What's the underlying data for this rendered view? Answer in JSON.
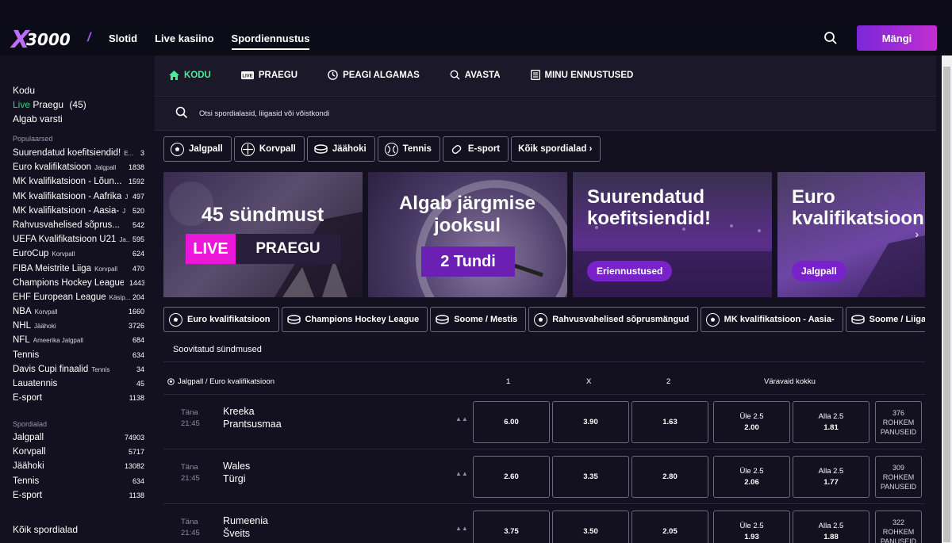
{
  "header": {
    "logo_text": "3000",
    "logo_mark": "X",
    "nav": [
      "Slotid",
      "Live kasiino",
      "Spordiennustus"
    ],
    "play_button": "Mängi"
  },
  "sidebar": {
    "main_items": [
      {
        "label": "Kodu"
      },
      {
        "label_live": "Live",
        "label": "Praegu",
        "count": "(45)"
      },
      {
        "label": "Algab varsti"
      }
    ],
    "popular_heading": "Populaarsed",
    "popular": [
      {
        "name": "Suurendatud koefitsiendid!",
        "sub": "E...",
        "count": "3"
      },
      {
        "name": "Euro kvalifikatsioon",
        "sub": "Jalgpall",
        "count": "1838"
      },
      {
        "name": "MK kvalifikatsioon - Lõun...",
        "sub": "",
        "count": "1592"
      },
      {
        "name": "MK kvalifikatsioon - Aafrika",
        "sub": "J",
        "count": "497"
      },
      {
        "name": "MK kvalifikatsioon - Aasia-",
        "sub": "J",
        "count": "520"
      },
      {
        "name": "Rahvusvahelised sõprus...",
        "sub": "",
        "count": "542"
      },
      {
        "name": "UEFA Kvalifikatsioon U21",
        "sub": "Ja...",
        "count": "595"
      },
      {
        "name": "EuroCup",
        "sub": "Korvpall",
        "count": "624"
      },
      {
        "name": "FIBA Meistrite Liiga",
        "sub": "Korvpall",
        "count": "470"
      },
      {
        "name": "Champions Hockey League",
        "sub": "J",
        "count": "1443"
      },
      {
        "name": "EHF European League",
        "sub": "Käsip...",
        "count": "204"
      },
      {
        "name": "NBA",
        "sub": "Korvpall",
        "count": "1660"
      },
      {
        "name": "NHL",
        "sub": "Jäähoki",
        "count": "3726"
      },
      {
        "name": "NFL",
        "sub": "Ameerika Jalgpall",
        "count": "684"
      },
      {
        "name": "Tennis",
        "sub": "",
        "count": "634"
      },
      {
        "name": "Davis Cupi finaalid",
        "sub": "Tennis",
        "count": "34"
      },
      {
        "name": "Lauatennis",
        "sub": "",
        "count": "45"
      },
      {
        "name": "E-sport",
        "sub": "",
        "count": "1138"
      }
    ],
    "sports_heading": "Spordialad",
    "sports": [
      {
        "name": "Jalgpall",
        "count": "74903"
      },
      {
        "name": "Korvpall",
        "count": "5717"
      },
      {
        "name": "Jäähoki",
        "count": "13082"
      },
      {
        "name": "Tennis",
        "count": "634"
      },
      {
        "name": "E-sport",
        "count": "1138"
      }
    ],
    "all_sports": "Kõik spordialad"
  },
  "subnav": [
    "KODU",
    "PRAEGU",
    "PEAGI ALGAMAS",
    "AVASTA",
    "MINU ENNUSTUSED"
  ],
  "search": {
    "placeholder": "Otsi spordialasid, liigasid või võistkondi"
  },
  "sport_buttons": [
    "Jalgpall",
    "Korvpall",
    "Jäähoki",
    "Tennis",
    "E-sport",
    "Kõik spordialad ›"
  ],
  "banners": {
    "b1": {
      "title": "45 sündmust",
      "live": "LIVE",
      "praegu": "PRAEGU"
    },
    "b2": {
      "title": "Algab järgmise jooksul",
      "badge": "2 Tundi"
    },
    "b3": {
      "title": "Suurendatud koefitsiendid!",
      "pill": "Eriennustused"
    },
    "b4": {
      "title": "Euro kvalifikatsioon",
      "pill": "Jalgpall",
      "arrow": "›"
    }
  },
  "league_buttons": [
    "Euro kvalifikatsioon",
    "Champions Hockey League",
    "Soome / Mestis",
    "Rahvusvahelised sõprusmängud",
    "MK kvalifikatsioon - Aasia-",
    "Soome / Liiga ›"
  ],
  "featured_title": "Soovitatud sündmused",
  "events_header": {
    "league": "Jalgpall / Euro kvalifikatsioon",
    "col1": "1",
    "colx": "X",
    "col2": "2",
    "total": "Väravaid kokku"
  },
  "events": [
    {
      "day": "Täna",
      "time": "21:45",
      "home": "Kreeka",
      "away": "Prantsusmaa",
      "o1": "6.00",
      "ox": "3.90",
      "o2": "1.63",
      "over_lbl": "Üle 2.5",
      "over": "2.00",
      "under_lbl": "Alla 2.5",
      "under": "1.81",
      "more_n": "376",
      "more_a": "ROHKEM",
      "more_b": "PANUSEID"
    },
    {
      "day": "Täna",
      "time": "21:45",
      "home": "Wales",
      "away": "Türgi",
      "o1": "2.60",
      "ox": "3.35",
      "o2": "2.80",
      "over_lbl": "Üle 2.5",
      "over": "2.06",
      "under_lbl": "Alla 2.5",
      "under": "1.77",
      "more_n": "309",
      "more_a": "ROHKEM",
      "more_b": "PANUSEID"
    },
    {
      "day": "Täna",
      "time": "21:45",
      "home": "Rumeenia",
      "away": "Šveits",
      "o1": "3.75",
      "ox": "3.50",
      "o2": "2.05",
      "over_lbl": "Üle 2.5",
      "over": "1.93",
      "under_lbl": "Alla 2.5",
      "under": "1.88",
      "more_n": "322",
      "more_a": "ROHKEM",
      "more_b": "PANUSEID"
    }
  ],
  "colors": {
    "accent": "#7a22c9",
    "live_green": "#35d07f",
    "live_pink": "#ec16d8",
    "bg": "#13111f"
  }
}
